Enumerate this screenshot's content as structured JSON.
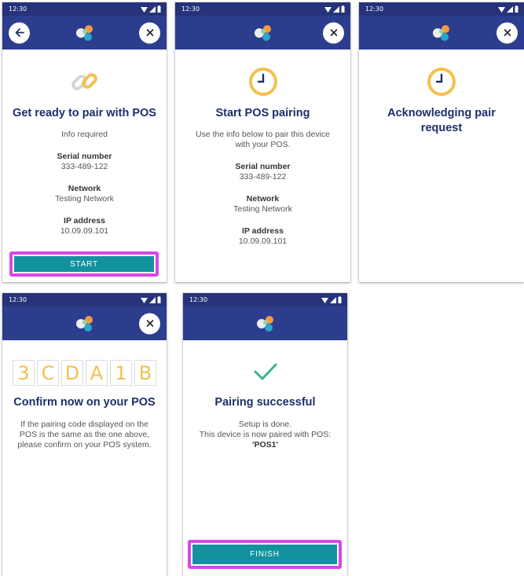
{
  "status": {
    "time": "12:30"
  },
  "screens": {
    "ready": {
      "title": "Get ready to pair with POS",
      "info_required": "Info required",
      "serial_label": "Serial number",
      "serial_value": "333-489-122",
      "network_label": "Network",
      "network_value": "Testing Network",
      "ip_label": "IP address",
      "ip_value": "10.09.09.101",
      "start_label": "START"
    },
    "start_pairing": {
      "title": "Start POS pairing",
      "instructions": "Use the info below to pair this device with your POS.",
      "serial_label": "Serial number",
      "serial_value": "333-489-122",
      "network_label": "Network",
      "network_value": "Testing Network",
      "ip_label": "IP address",
      "ip_value": "10.09.09.101"
    },
    "acknowledging": {
      "title": "Acknowledging pair request"
    },
    "confirm": {
      "code": [
        "3",
        "C",
        "D",
        "A",
        "1",
        "B"
      ],
      "title": "Confirm now on your POS",
      "instructions": "If the pairing code displayed on the POS is the same as the one above, please confirm on your POS system."
    },
    "success": {
      "title": "Pairing successful",
      "line1": "Setup is done.",
      "line2": "This device is now paired with POS:",
      "pos_name": "'POS1'",
      "finish_label": "FINISH"
    }
  },
  "icons": {
    "back": "arrow-left-icon",
    "close": "close-icon",
    "logo": "app-logo",
    "link": "link-icon",
    "clock": "clock-icon",
    "check": "check-icon"
  },
  "colors": {
    "header": "#2d3d8e",
    "statusbar": "#26337a",
    "title": "#1f2d6b",
    "button": "#12929f",
    "highlight": "#d548e6",
    "code": "#f2c14e",
    "check": "#3cb48a"
  }
}
